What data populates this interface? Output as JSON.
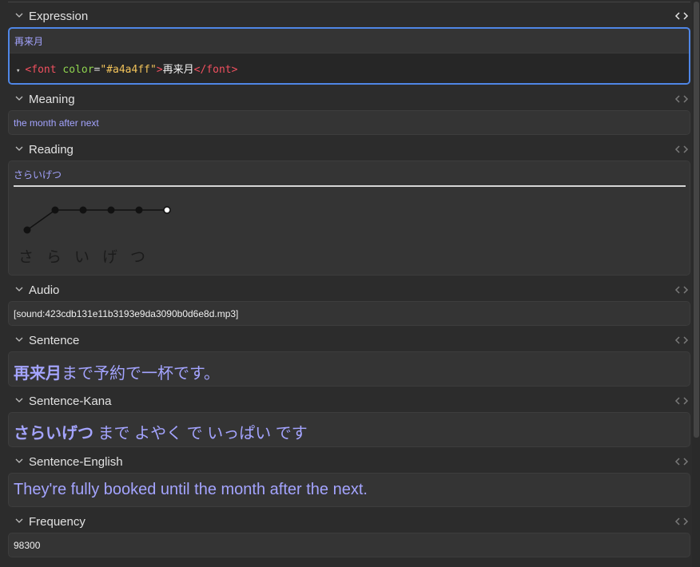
{
  "fields": {
    "expression": {
      "label": "Expression",
      "value": "再来月",
      "html_line": {
        "open_tag": "<font",
        "attr": "color",
        "eq": "=",
        "attr_value": "\"#a4a4ff\"",
        "close_bracket": ">",
        "text": "再来月",
        "end_tag": "</font>"
      }
    },
    "meaning": {
      "label": "Meaning",
      "value": "the month after next"
    },
    "reading": {
      "label": "Reading",
      "value": "さらいげつ",
      "morae": [
        "さ",
        "ら",
        "い",
        "げ",
        "つ"
      ],
      "pitch_levels": [
        "low",
        "high",
        "high",
        "high",
        "high",
        "high"
      ]
    },
    "audio": {
      "label": "Audio",
      "value": "[sound:423cdb131e11b3193e9da3090b0d6e8d.mp3]"
    },
    "sentence": {
      "label": "Sentence",
      "bold": "再来月",
      "rest": "まで予約で一杯です。"
    },
    "sentence_kana": {
      "label": "Sentence-Kana",
      "bold": "さらいげつ",
      "rest": " まで よやく で いっぱい です"
    },
    "sentence_english": {
      "label": "Sentence-English",
      "value": "They're fully booked until the month after the next."
    },
    "frequency": {
      "label": "Frequency",
      "value": "98300"
    }
  },
  "icons": {
    "chevron": "chevron-down-icon",
    "toggle": "code-toggle-icon",
    "triangle": "▾"
  },
  "colors": {
    "field_text": "#a4a4ff",
    "focus_border": "#4f86e6",
    "tag": "#f0505f",
    "attribute": "#8fd44f",
    "string": "#f2c35a"
  }
}
